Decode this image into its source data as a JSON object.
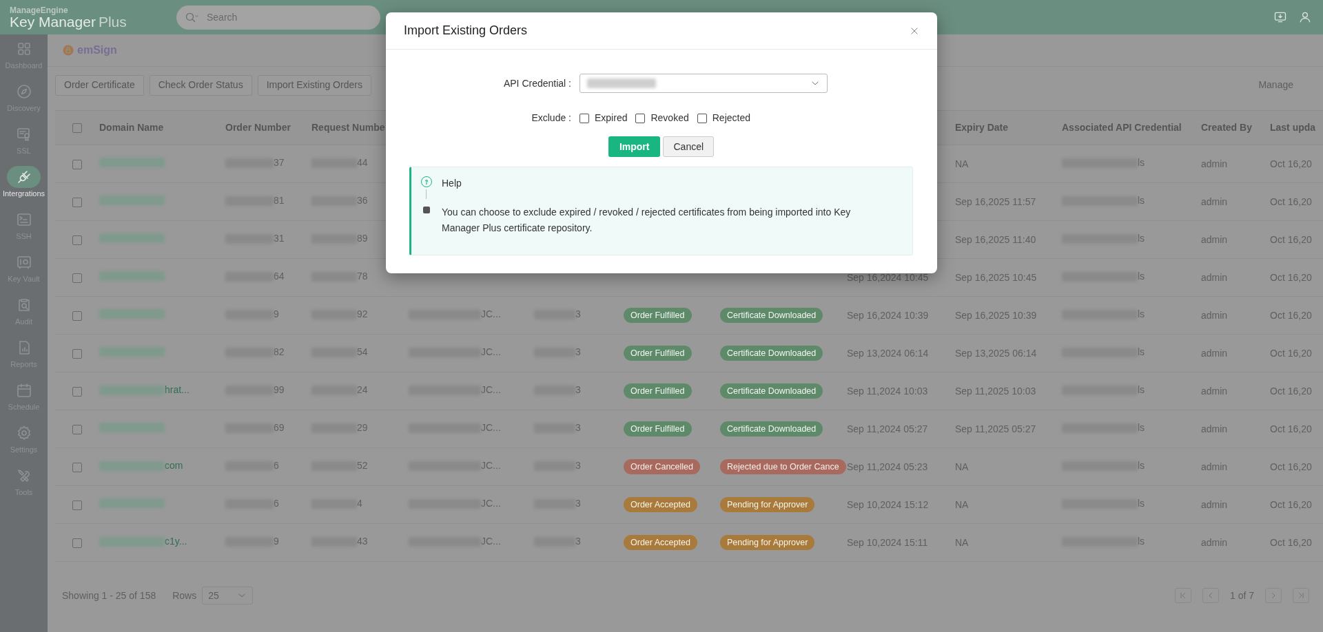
{
  "header": {
    "brand_top": "ManageEngine",
    "brand_main": "Key Manager",
    "brand_suffix": "Plus",
    "search": {
      "placeholder": "Search"
    }
  },
  "sidebar": {
    "items": [
      {
        "label": "Dashboard",
        "selected": false
      },
      {
        "label": "Discovery",
        "selected": false
      },
      {
        "label": "SSL",
        "selected": false
      },
      {
        "label": "Intergrations",
        "selected": true
      },
      {
        "label": "SSH",
        "selected": false
      },
      {
        "label": "Key Vault",
        "selected": false
      },
      {
        "label": "Audit",
        "selected": false
      },
      {
        "label": "Reports",
        "selected": false
      },
      {
        "label": "Schedule",
        "selected": false
      },
      {
        "label": "Settings",
        "selected": false
      },
      {
        "label": "Tools",
        "selected": false
      }
    ]
  },
  "vendor": {
    "name": "emSign"
  },
  "toolbar": {
    "buttons": [
      "Order Certificate",
      "Check Order Status",
      "Import Existing Orders"
    ],
    "link": "Manage"
  },
  "table": {
    "select_all_checked": false,
    "columns": [
      "Domain Name",
      "Order Number",
      "Request Numbe",
      "Expiry Date",
      "Associated API Credential",
      "Created By",
      "Last upda"
    ],
    "rows": [
      {
        "checked": false,
        "order_number": "37",
        "request_number": "44",
        "expiry_date": "NA",
        "api_credential": "ls",
        "created_by": "admin",
        "last_updated": "Oct 16,20"
      },
      {
        "checked": false,
        "order_number": "81",
        "request_number": "36",
        "expiry_date": "Sep 16,2025 11:57",
        "api_credential": "ls",
        "created_by": "admin",
        "last_updated": "Oct 16,20"
      },
      {
        "checked": false,
        "order_number": "31",
        "request_number": "89",
        "expiry_date": "Sep 16,2025 11:40",
        "api_credential": "ls",
        "created_by": "admin",
        "last_updated": "Oct 16,20"
      },
      {
        "checked": false,
        "order_number": "64",
        "request_number": "78",
        "created": "Sep 16,2024 10:45",
        "expiry_date": "Sep 16,2025 10:45",
        "api_credential": "ls",
        "created_by": "admin",
        "last_updated": "Oct 16,20"
      },
      {
        "checked": false,
        "order_number": "9",
        "request_number": "92",
        "column_4": "JC...",
        "column_5": "3",
        "order_status": {
          "text": "Order Fulfilled",
          "kind": "fulfilled"
        },
        "certificate_status": {
          "text": "Certificate Downloaded",
          "kind": "fulfilled"
        },
        "created": "Sep 16,2024 10:39",
        "expiry_date": "Sep 16,2025 10:39",
        "api_credential": "ls",
        "created_by": "admin",
        "last_updated": "Oct 16,20"
      },
      {
        "checked": false,
        "order_number": "82",
        "request_number": "54",
        "column_4": "JC...",
        "column_5": "3",
        "order_status": {
          "text": "Order Fulfilled",
          "kind": "fulfilled"
        },
        "certificate_status": {
          "text": "Certificate Downloaded",
          "kind": "fulfilled"
        },
        "created": "Sep 13,2024 06:14",
        "expiry_date": "Sep 13,2025 06:14",
        "api_credential": "ls",
        "created_by": "admin",
        "last_updated": "Oct 16,20"
      },
      {
        "checked": false,
        "domain": "hrat...",
        "order_number": "99",
        "request_number": "24",
        "column_4": "JC...",
        "column_5": "3",
        "order_status": {
          "text": "Order Fulfilled",
          "kind": "fulfilled"
        },
        "certificate_status": {
          "text": "Certificate Downloaded",
          "kind": "fulfilled"
        },
        "created": "Sep 11,2024 10:03",
        "expiry_date": "Sep 11,2025 10:03",
        "api_credential": "ls",
        "created_by": "admin",
        "last_updated": "Oct 16,20"
      },
      {
        "checked": false,
        "order_number": "69",
        "request_number": "29",
        "column_4": "JC...",
        "column_5": "3",
        "order_status": {
          "text": "Order Fulfilled",
          "kind": "fulfilled"
        },
        "certificate_status": {
          "text": "Certificate Downloaded",
          "kind": "fulfilled"
        },
        "created": "Sep 11,2024 05:27",
        "expiry_date": "Sep 11,2025 05:27",
        "api_credential": "ls",
        "created_by": "admin",
        "last_updated": "Oct 16,20"
      },
      {
        "checked": false,
        "domain": "com",
        "order_number": "6",
        "request_number": "52",
        "column_4": "JC...",
        "column_5": "3",
        "order_status": {
          "text": "Order Cancelled",
          "kind": "cancelled"
        },
        "certificate_status": {
          "text": "Rejected due to Order Cance",
          "kind": "cancelled"
        },
        "created": "Sep 11,2024 05:23",
        "expiry_date": "NA",
        "api_credential": "ls",
        "created_by": "admin",
        "last_updated": "Oct 16,20"
      },
      {
        "checked": false,
        "order_number": "6",
        "request_number": "4",
        "column_4": "JC...",
        "column_5": "3",
        "order_status": {
          "text": "Order Accepted",
          "kind": "accepted"
        },
        "certificate_status": {
          "text": "Pending for Approver",
          "kind": "accepted"
        },
        "created": "Sep 10,2024 15:12",
        "expiry_date": "NA",
        "api_credential": "ls",
        "created_by": "admin",
        "last_updated": "Oct 16,20"
      },
      {
        "checked": false,
        "domain": "c1y...",
        "order_number": "9",
        "request_number": "43",
        "column_4": "JC...",
        "column_5": "3",
        "order_status": {
          "text": "Order Accepted",
          "kind": "accepted"
        },
        "certificate_status": {
          "text": "Pending for Approver",
          "kind": "accepted"
        },
        "created": "Sep 10,2024 15:11",
        "expiry_date": "NA",
        "api_credential": "ls",
        "created_by": "admin",
        "last_updated": "Oct 16,20"
      }
    ]
  },
  "footer": {
    "showing": "Showing 1 - 25 of 158",
    "rows_label": "Rows",
    "rows_value": "25",
    "page": "1 of 7"
  },
  "dialog": {
    "title": "Import Existing Orders",
    "api_credential_label": "API Credential :",
    "exclude_label": "Exclude :",
    "excludes": [
      {
        "label": "Expired",
        "checked": false
      },
      {
        "label": "Revoked",
        "checked": false
      },
      {
        "label": "Rejected",
        "checked": false
      }
    ],
    "buttons": [
      {
        "label": "Import",
        "kind": "primary"
      },
      {
        "label": "Cancel",
        "kind": "secondary"
      }
    ],
    "help": {
      "title": "Help",
      "text": "You can choose to exclude expired / revoked / rejected certificates from being imported into Key Manager Plus certificate repository."
    }
  }
}
